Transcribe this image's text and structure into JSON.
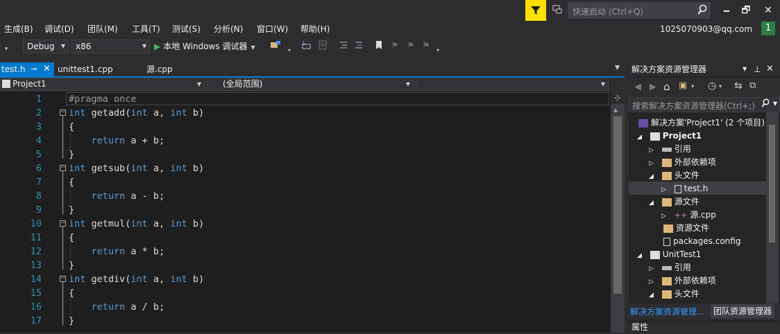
{
  "titlebar": {
    "quick_launch_placeholder": "快速启动 (Ctrl+Q)",
    "minimize": "🗕",
    "restore": "🗗",
    "close": "✕",
    "accent": "#fce100"
  },
  "menu": [
    {
      "label": "生成(B)"
    },
    {
      "label": "调试(D)"
    },
    {
      "label": "团队(M)"
    },
    {
      "label": "工具(T)"
    },
    {
      "label": "测试(S)"
    },
    {
      "label": "分析(N)"
    },
    {
      "label": "窗口(W)"
    },
    {
      "label": "帮助(H)"
    }
  ],
  "account": {
    "email": "1025070903@qq.com",
    "notifications": "1"
  },
  "toolbar": {
    "config": "Debug",
    "platform": "x86",
    "run_label": "本地 Windows 调试器"
  },
  "tabs": [
    {
      "label": "test.h",
      "active": true
    },
    {
      "label": "unittest1.cpp"
    },
    {
      "label": "源.cpp"
    }
  ],
  "navbar": {
    "project": "Project1",
    "scope": "(全局范围)",
    "member": ""
  },
  "editor": {
    "lines": [
      {
        "n": "1",
        "code": "#pragma once"
      },
      {
        "n": "2",
        "code": "int getadd(int a, int b)"
      },
      {
        "n": "3",
        "code": "{"
      },
      {
        "n": "4",
        "code": "    return a + b;"
      },
      {
        "n": "5",
        "code": "}"
      },
      {
        "n": "6",
        "code": "int getsub(int a, int b)"
      },
      {
        "n": "7",
        "code": "{"
      },
      {
        "n": "8",
        "code": "    return a - b;"
      },
      {
        "n": "9",
        "code": "}"
      },
      {
        "n": "10",
        "code": "int getmul(int a, int b)"
      },
      {
        "n": "11",
        "code": "{"
      },
      {
        "n": "12",
        "code": "    return a * b;"
      },
      {
        "n": "13",
        "code": "}"
      },
      {
        "n": "14",
        "code": "int getdiv(int a, int b)"
      },
      {
        "n": "15",
        "code": "{"
      },
      {
        "n": "16",
        "code": "    return a / b;"
      },
      {
        "n": "17",
        "code": "}"
      }
    ]
  },
  "solution_explorer": {
    "title": "解决方案资源管理器",
    "search_placeholder": "搜索解决方案资源管理器(Ctrl+;)",
    "items": [
      {
        "label": "解决方案'Project1' (2 个项目)"
      },
      {
        "label": "Project1"
      },
      {
        "label": "引用"
      },
      {
        "label": "外部依赖项"
      },
      {
        "label": "头文件"
      },
      {
        "label": "test.h"
      },
      {
        "label": "源文件"
      },
      {
        "label": "源.cpp"
      },
      {
        "label": "资源文件"
      },
      {
        "label": "packages.config"
      },
      {
        "label": "UnitTest1"
      },
      {
        "label": "引用"
      },
      {
        "label": "外部依赖项"
      },
      {
        "label": "头文件"
      }
    ],
    "bottom_tabs": [
      {
        "label": "解决方案资源管理..."
      },
      {
        "label": "团队资源管理器"
      }
    ],
    "properties_title": "属性"
  }
}
